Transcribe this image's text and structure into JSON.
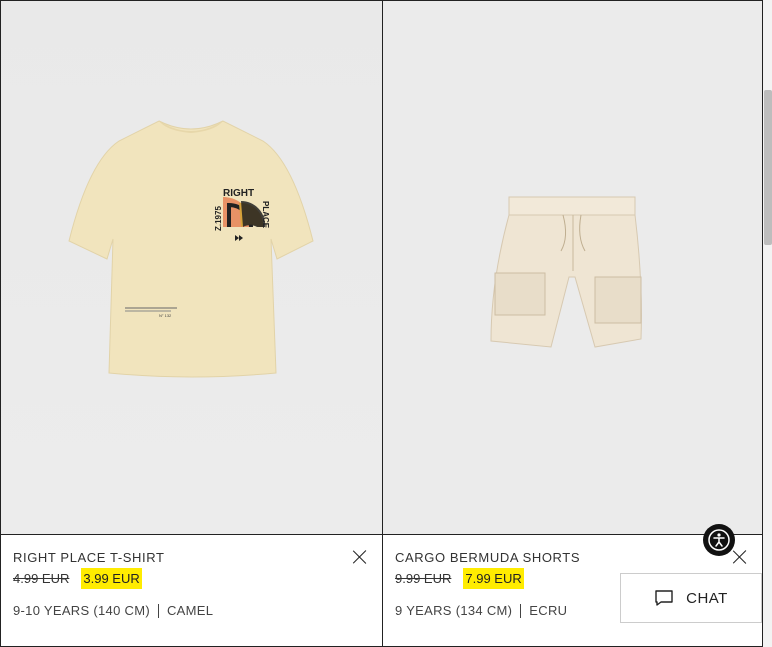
{
  "products": [
    {
      "name": "RIGHT PLACE T-SHIRT",
      "old_price": "4.99 EUR",
      "new_price": "3.99 EUR",
      "size": "9-10 YEARS (140 CM)",
      "color": "CAMEL",
      "print": {
        "top": "RIGHT",
        "side_left": "Z.1975",
        "side_right": "PLACE",
        "tag": "N° 132"
      }
    },
    {
      "name": "CARGO BERMUDA SHORTS",
      "old_price": "9.99 EUR",
      "new_price": "7.99 EUR",
      "size": "9 YEARS (134 CM)",
      "color": "ECRU"
    }
  ],
  "chat": {
    "label": "CHAT"
  },
  "colors": {
    "highlight": "#ffec00",
    "border": "#222222",
    "image_bg": "#ebebeb"
  }
}
